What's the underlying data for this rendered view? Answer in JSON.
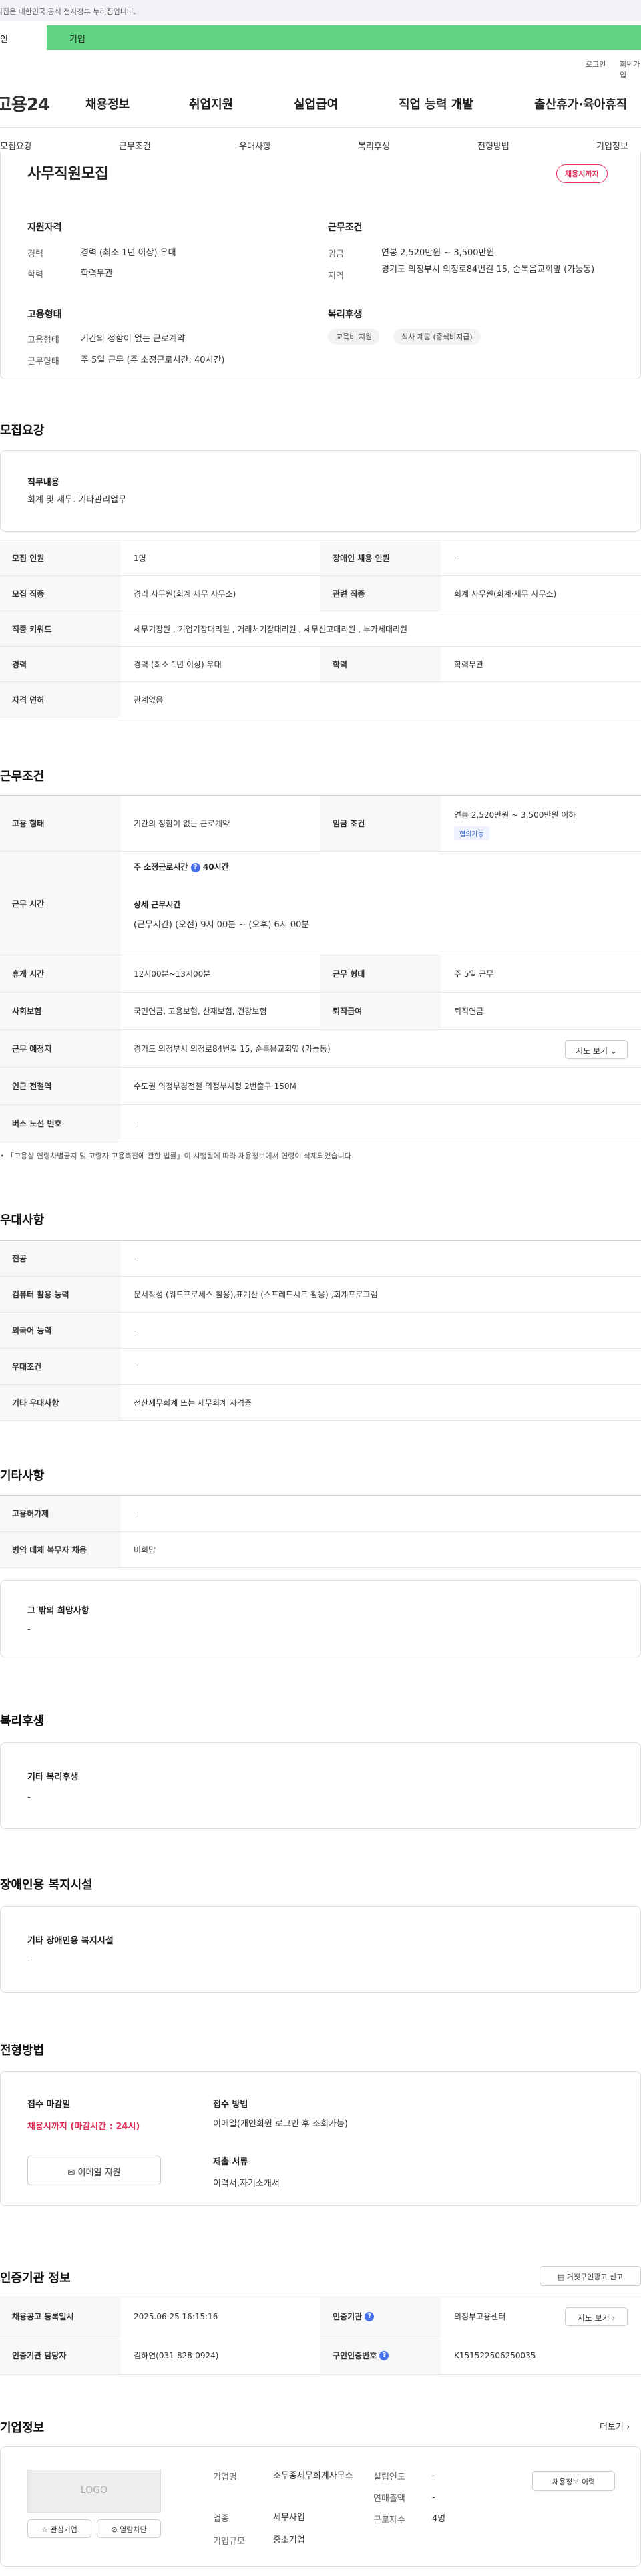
{
  "header": {
    "gov_notice": "이 누리집은 대한민국 공식 전자정부 누리집입니다.",
    "tab_personal": "개인",
    "tab_corp": "기업",
    "login": "로그인",
    "signup": "회원가입",
    "logo": "고용24",
    "gnb": [
      "채용정보",
      "취업지원",
      "실업급여",
      "직업 능력 개발",
      "출산휴가·육아휴직"
    ],
    "subnav": [
      "모집요강",
      "근무조건",
      "우대사항",
      "복리후생",
      "전형방법",
      "기업정보"
    ]
  },
  "summary": {
    "title": "사무직원모집",
    "badge": "채용시까지",
    "qual_heading": "지원자격",
    "career_label": "경력",
    "career_value": "경력 (최소 1년 이상) 우대",
    "edu_label": "학력",
    "edu_value": "학력무관",
    "cond_heading": "근무조건",
    "wage_label": "임금",
    "wage_value": "연봉 2,520만원 ~ 3,500만원",
    "region_label": "지역",
    "region_value": "경기도 의정부시 의정로84번길 15, 순복음교회옆 (가능동)",
    "emp_heading": "고용형태",
    "emptype_label": "고용형태",
    "emptype_value": "기간의 정함이 없는 근로계약",
    "worktype_label": "근무형태",
    "worktype_value": "주 5일 근무 (주 소정근로시간: 40시간)",
    "welfare_heading": "복리후생",
    "welfare_pills": [
      "교육비 지원",
      "식사 제공 (중식비지급)"
    ]
  },
  "recruit": {
    "title": "모집요강",
    "duty_heading": "직무내용",
    "duty_value": "회계 및 세무. 기타관리업무",
    "rows": {
      "headcount_label": "모집 인원",
      "headcount_value": "1명",
      "disabled_label": "장애인 채용 인원",
      "disabled_value": "-",
      "job_label": "모집 직종",
      "job_value": "경리 사무원(회계·세무 사무소)",
      "related_label": "관련 직종",
      "related_value": "회계 사무원(회계·세무 사무소)",
      "keyword_label": "직종 키워드",
      "keyword_value": "세무기장원 , 기업기장대리원 , 거래처기장대리원 , 세무신고대리원 , 부가세대리원",
      "career_label": "경력",
      "career_value": "경력 (최소 1년 이상) 우대",
      "edu_label": "학력",
      "edu_value": "학력무관",
      "license_label": "자격 면허",
      "license_value": "관계없음"
    }
  },
  "conditions": {
    "title": "근무조건",
    "emptype_label": "고용 형태",
    "emptype_value": "기간의 정함이 없는 근로계약",
    "wage_label": "임금 조건",
    "wage_value": "연봉 2,520만원 ~ 3,500만원 이하",
    "wage_badge": "협의가능",
    "hours_label": "근무 시간",
    "hours_week_title": "주 소정근로시간",
    "hours_week_value": "40시간",
    "hours_detail_title": "상세 근무시간",
    "hours_detail_value": "(근무시간) (오전) 9시 00분 ~ (오후) 6시 00분",
    "rest_label": "휴게 시간",
    "rest_value": "12시00분~13시00분",
    "worktype_label": "근무 형태",
    "worktype_value": "주 5일 근무",
    "insurance_label": "사회보험",
    "insurance_value": "국민연금, 고용보험, 산재보험, 건강보험",
    "retire_label": "퇴직급여",
    "retire_value": "퇴직연금",
    "place_label": "근무 예정지",
    "place_value": "경기도 의정부시 의정로84번길 15, 순복음교회옆 (가능동)",
    "map_button": "지도 보기",
    "station_label": "인근 전철역",
    "station_value": "수도권 의정부경전철 의정부시청 2번출구 150M",
    "bus_label": "버스 노선 번호",
    "bus_value": "-",
    "notice": "「고용상 연령차별금지 및 고령자 고용촉진에 관한 법률」이 시행됨에 따라 채용정보에서 연령이 삭제되었습니다."
  },
  "preference": {
    "title": "우대사항",
    "major_label": "전공",
    "major_value": "-",
    "computer_label": "컴퓨터 활용 능력",
    "computer_value": "문서작성 (워드프로세스 활용),표계산 (스프레드시트 활용) ,회계프로그램",
    "lang_label": "외국어 능력",
    "lang_value": "-",
    "cond_label": "우대조건",
    "cond_value": "-",
    "etc_label": "기타 우대사항",
    "etc_value": "전산세무회계 또는 세무회계 자격증"
  },
  "other": {
    "title": "기타사항",
    "device_label": "고용허가제",
    "device_value": "-",
    "military_label": "병역 대체 복무자 채용",
    "military_value": "비희망",
    "extra_heading": "그 밖의 희망사항",
    "extra_value": "-"
  },
  "welfare": {
    "title": "복리후생",
    "heading": "기타 복리후생",
    "value": "-"
  },
  "disability": {
    "title": "장애인용 복지시설",
    "heading": "기타 장애인용 복지시설",
    "value": "-"
  },
  "selection": {
    "title": "전형방법",
    "deadline_heading": "접수 마감일",
    "deadline_value": "채용시까지 (마감시간 : 24시)",
    "email_button": "이메일 지원",
    "method_heading": "접수 방법",
    "method_value": "이메일(개인회원 로그인 후 조회가능)",
    "docs_heading": "제출 서류",
    "docs_value": "이력서,자기소개서"
  },
  "agency": {
    "title": "인증기관 정보",
    "report_button": "거짓구인광고 신고",
    "reg_label": "채용공고 등록일시",
    "reg_value": "2025.06.25 16:15:16",
    "org_label": "인증기관",
    "org_value": "의정부고용센터",
    "map_button": "지도 보기",
    "manager_label": "인증기관 담당자",
    "manager_value": "김하연(031-828-0924)",
    "notice_no_label": "구인인증번호",
    "notice_no_value": "K151522506250035"
  },
  "company": {
    "title": "기업정보",
    "more": "더보기",
    "logo_placeholder": "LOGO",
    "fav_button": "관심기업",
    "block_button": "열람차단",
    "name_label": "기업명",
    "name_value": "조두종세무회계사무소",
    "industry_label": "업종",
    "industry_value": "세무사업",
    "size_label": "기업규모",
    "size_value": "중소기업",
    "founded_label": "설립연도",
    "founded_value": "-",
    "revenue_label": "연매출액",
    "revenue_value": "-",
    "employees_label": "근로자수",
    "employees_value": "4명",
    "history_button": "채용정보 이력"
  }
}
